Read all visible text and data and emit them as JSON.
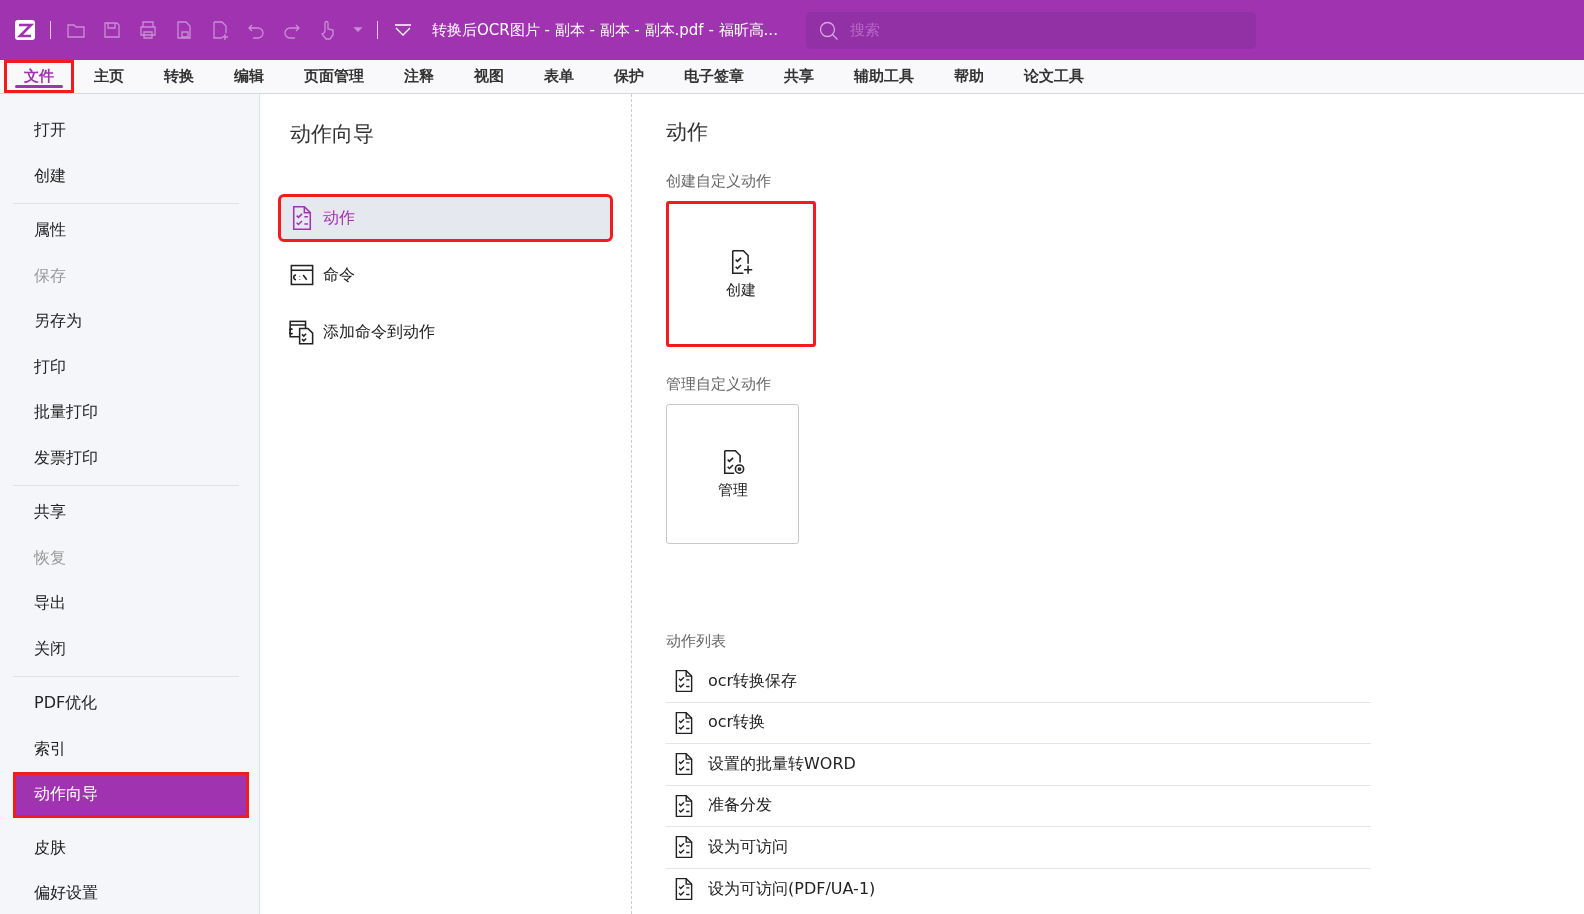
{
  "window": {
    "title": "转换后OCR图片 - 副本 - 副本 - 副本.pdf - 福昕高..."
  },
  "search": {
    "placeholder": "搜索"
  },
  "tabs": [
    {
      "label": "文件",
      "selected": true,
      "highlighted": true
    },
    {
      "label": "主页",
      "selected": false,
      "highlighted": false
    },
    {
      "label": "转换",
      "selected": false,
      "highlighted": false
    },
    {
      "label": "编辑",
      "selected": false,
      "highlighted": false
    },
    {
      "label": "页面管理",
      "selected": false,
      "highlighted": false
    },
    {
      "label": "注释",
      "selected": false,
      "highlighted": false
    },
    {
      "label": "视图",
      "selected": false,
      "highlighted": false
    },
    {
      "label": "表单",
      "selected": false,
      "highlighted": false
    },
    {
      "label": "保护",
      "selected": false,
      "highlighted": false
    },
    {
      "label": "电子签章",
      "selected": false,
      "highlighted": false
    },
    {
      "label": "共享",
      "selected": false,
      "highlighted": false
    },
    {
      "label": "辅助工具",
      "selected": false,
      "highlighted": false
    },
    {
      "label": "帮助",
      "selected": false,
      "highlighted": false
    },
    {
      "label": "论文工具",
      "selected": false,
      "highlighted": false
    }
  ],
  "sidebar": {
    "groups": [
      {
        "separator": true,
        "items": [
          {
            "label": "打开",
            "disabled": false,
            "selected": false,
            "highlighted": false
          },
          {
            "label": "创建",
            "disabled": false,
            "selected": false,
            "highlighted": false
          }
        ]
      },
      {
        "separator": true,
        "items": [
          {
            "label": "属性",
            "disabled": false,
            "selected": false,
            "highlighted": false
          },
          {
            "label": "保存",
            "disabled": true,
            "selected": false,
            "highlighted": false
          },
          {
            "label": "另存为",
            "disabled": false,
            "selected": false,
            "highlighted": false
          },
          {
            "label": "打印",
            "disabled": false,
            "selected": false,
            "highlighted": false
          },
          {
            "label": "批量打印",
            "disabled": false,
            "selected": false,
            "highlighted": false
          },
          {
            "label": "发票打印",
            "disabled": false,
            "selected": false,
            "highlighted": false
          }
        ]
      },
      {
        "separator": true,
        "items": [
          {
            "label": "共享",
            "disabled": false,
            "selected": false,
            "highlighted": false
          },
          {
            "label": "恢复",
            "disabled": true,
            "selected": false,
            "highlighted": false
          },
          {
            "label": "导出",
            "disabled": false,
            "selected": false,
            "highlighted": false
          },
          {
            "label": "关闭",
            "disabled": false,
            "selected": false,
            "highlighted": false
          }
        ]
      },
      {
        "separator": false,
        "items": [
          {
            "label": "PDF优化",
            "disabled": false,
            "selected": false,
            "highlighted": false
          },
          {
            "label": "索引",
            "disabled": false,
            "selected": false,
            "highlighted": false
          },
          {
            "label": "动作向导",
            "disabled": false,
            "selected": true,
            "highlighted": true
          }
        ]
      },
      {
        "separator": false,
        "items": [
          {
            "label": "皮肤",
            "disabled": false,
            "selected": false,
            "highlighted": false
          },
          {
            "label": "偏好设置",
            "disabled": false,
            "selected": false,
            "highlighted": false
          }
        ]
      }
    ]
  },
  "wizard": {
    "title": "动作向导",
    "items": [
      {
        "label": "动作",
        "kind": "action",
        "selected": true,
        "highlighted": true
      },
      {
        "label": "命令",
        "kind": "command",
        "selected": false,
        "highlighted": false
      },
      {
        "label": "添加命令到动作",
        "kind": "add",
        "selected": false,
        "highlighted": false
      }
    ]
  },
  "actions": {
    "title": "动作",
    "create_section": {
      "heading": "创建自定义动作",
      "card": {
        "label": "创建",
        "kind": "create",
        "highlighted": true
      }
    },
    "manage_section": {
      "heading": "管理自定义动作",
      "card": {
        "label": "管理",
        "kind": "manage",
        "highlighted": false
      }
    },
    "list": {
      "heading": "动作列表",
      "items": [
        "ocr转换保存",
        "ocr转换",
        "设置的批量转WORD",
        "准备分发",
        "设为可访问",
        "设为可访问(PDF/UA-1)"
      ]
    }
  }
}
